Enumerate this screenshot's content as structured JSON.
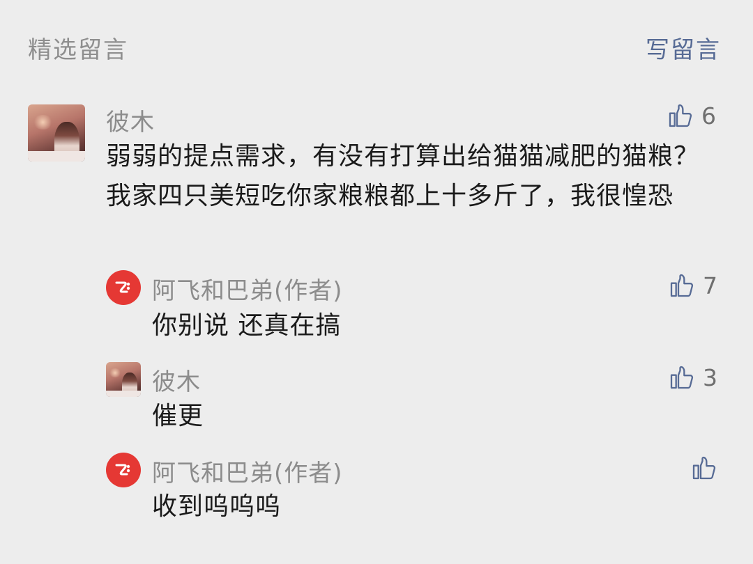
{
  "header": {
    "title": "精选留言",
    "write_label": "写留言"
  },
  "comments": [
    {
      "name": "彼木",
      "text": "弱弱的提点需求，有没有打算出给猫猫减肥的猫粮？我家四只美短吃你家粮粮都上十多斤了，我很惶恐",
      "likes": "6",
      "avatar": "photo-avatar"
    }
  ],
  "replies": [
    {
      "name": "阿飞和巴弟(作者)",
      "text": "你别说 还真在搞",
      "likes": "7",
      "avatar": "brand-logo"
    },
    {
      "name": "彼木",
      "text": "催更",
      "likes": "3",
      "avatar": "photo-avatar"
    },
    {
      "name": "阿飞和巴弟(作者)",
      "text": "收到呜呜呜",
      "likes": "",
      "avatar": "brand-logo"
    }
  ],
  "colors": {
    "background": "#ededed",
    "link": "#576b95",
    "logo": "#e53834",
    "name": "#8c8c8c"
  },
  "icons": [
    "thumbs-up-icon",
    "brand-logo-icon"
  ]
}
